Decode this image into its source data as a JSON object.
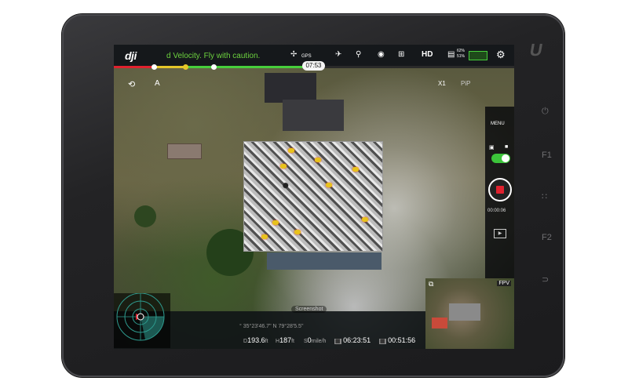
{
  "device": {
    "logo": "U",
    "hardware_buttons": [
      "⏻",
      "F1",
      "∷",
      "F2",
      "⊃"
    ]
  },
  "topbar": {
    "brand": "dji",
    "warning": "d Velocity. Fly with caution.",
    "gps_label": "GPS",
    "hd_label": "HD",
    "flight_time": "07:53",
    "battery_pct_1": "62%",
    "battery_pct_2": "51%"
  },
  "overlay": {
    "zoom_label": "X1",
    "pip_label": "PiP",
    "menu_label": "MENU",
    "rec_time": "00:00:06",
    "screenshot_label": "Screenshot",
    "fpv_label": "FPV"
  },
  "telemetry": {
    "coords": "° 35°23'46.7\" N 79°28'5.5\"",
    "d_label": "D",
    "d_value": "193.6",
    "d_unit": "ft",
    "h_label": "H",
    "h_value": "187",
    "h_unit": "ft",
    "s_label": "S",
    "s_value": "0",
    "s_unit": "mile/h",
    "time1": "06:23:51",
    "time2": "00:51:56"
  },
  "colors": {
    "accent_green": "#47cf3b",
    "record_red": "#e0212e",
    "warning_text": "#6dd33f"
  }
}
